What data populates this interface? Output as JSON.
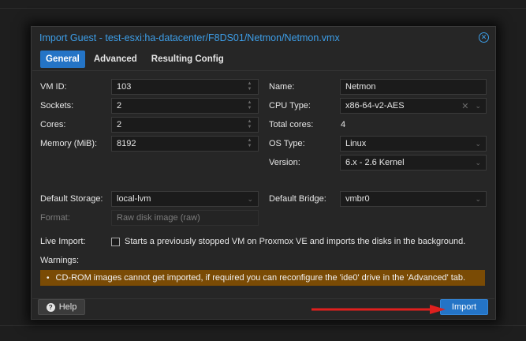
{
  "dialog": {
    "title": "Import Guest - test-esxi:ha-datacenter/F8DS01/Netmon/Netmon.vmx",
    "tabs": [
      {
        "label": "General",
        "active": true
      },
      {
        "label": "Advanced",
        "active": false
      },
      {
        "label": "Resulting Config",
        "active": false
      }
    ]
  },
  "left": {
    "vm_id": {
      "label": "VM ID:",
      "value": "103"
    },
    "sockets": {
      "label": "Sockets:",
      "value": "2"
    },
    "cores": {
      "label": "Cores:",
      "value": "2"
    },
    "memory": {
      "label": "Memory (MiB):",
      "value": "8192"
    },
    "storage": {
      "label": "Default Storage:",
      "value": "local-lvm"
    },
    "format": {
      "label": "Format:",
      "value": "Raw disk image (raw)"
    }
  },
  "right": {
    "name": {
      "label": "Name:",
      "value": "Netmon"
    },
    "cpu_type": {
      "label": "CPU Type:",
      "value": "x86-64-v2-AES"
    },
    "total_cores": {
      "label": "Total cores:",
      "value": "4"
    },
    "os_type": {
      "label": "OS Type:",
      "value": "Linux"
    },
    "version": {
      "label": "Version:",
      "value": "6.x - 2.6 Kernel"
    },
    "bridge": {
      "label": "Default Bridge:",
      "value": "vmbr0"
    }
  },
  "live_import": {
    "label": "Live Import:",
    "checked": false,
    "text": "Starts a previously stopped VM on Proxmox VE and imports the disks in the background."
  },
  "warnings": {
    "label": "Warnings:",
    "items": [
      "CD-ROM images cannot get imported, if required you can reconfigure the 'ide0' drive in the 'Advanced' tab."
    ]
  },
  "footer": {
    "help_label": "Help",
    "import_label": "Import"
  },
  "colors": {
    "accent": "#2474c6",
    "title": "#3d9ee8",
    "warning_bg": "#7a4b05",
    "arrow": "#e0201e"
  }
}
